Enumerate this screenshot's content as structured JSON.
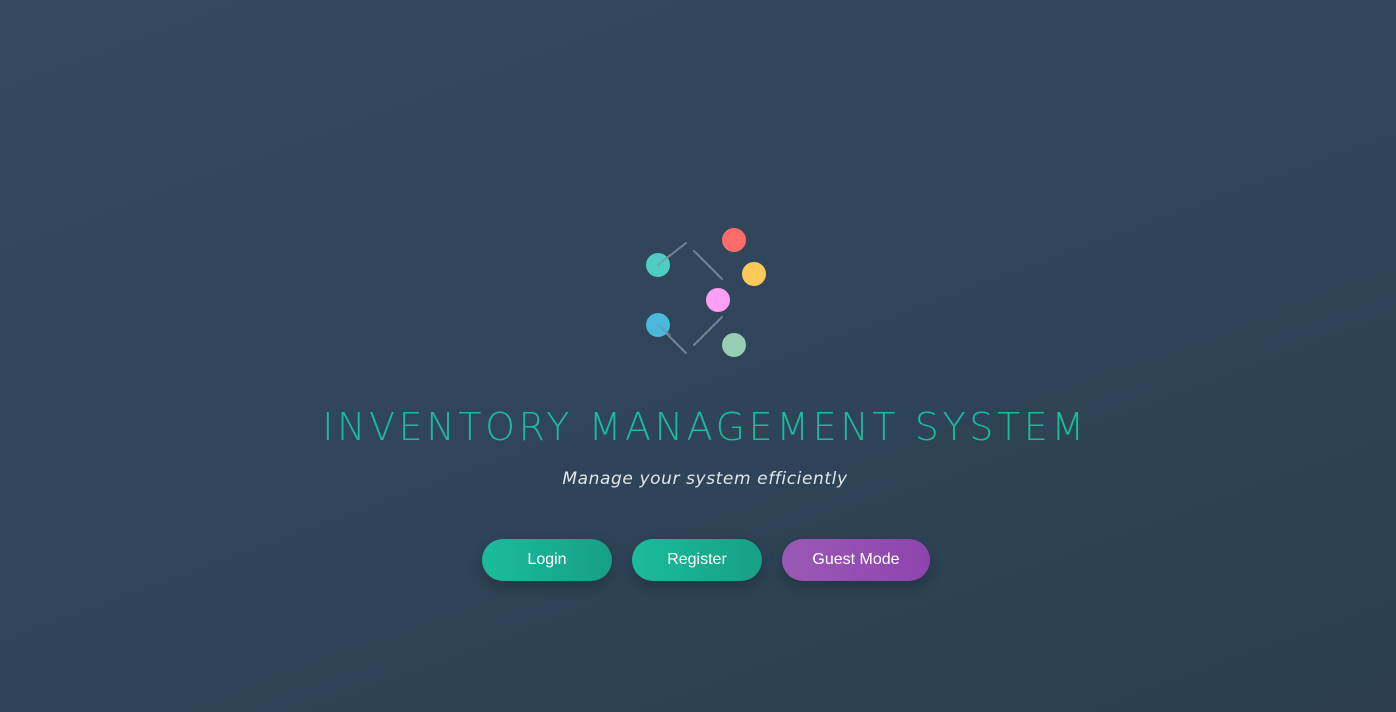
{
  "header": {
    "title": "INVENTORY MANAGEMENT SYSTEM",
    "subtitle": "Manage your system efficiently"
  },
  "actions": {
    "login_label": "Login",
    "register_label": "Register",
    "guest_label": "Guest Mode"
  },
  "colors": {
    "accent": "#1abc9c",
    "guest": "#9b59b6",
    "background": "#2c3e50",
    "node_teal": "#4ecdc4",
    "node_red": "#ff6b6b",
    "node_yellow": "#feca57",
    "node_pink": "#ff9ff3",
    "node_blue": "#48b9d8",
    "node_green": "#96ceb4"
  },
  "logo": {
    "icon": "molecule-network-icon"
  }
}
